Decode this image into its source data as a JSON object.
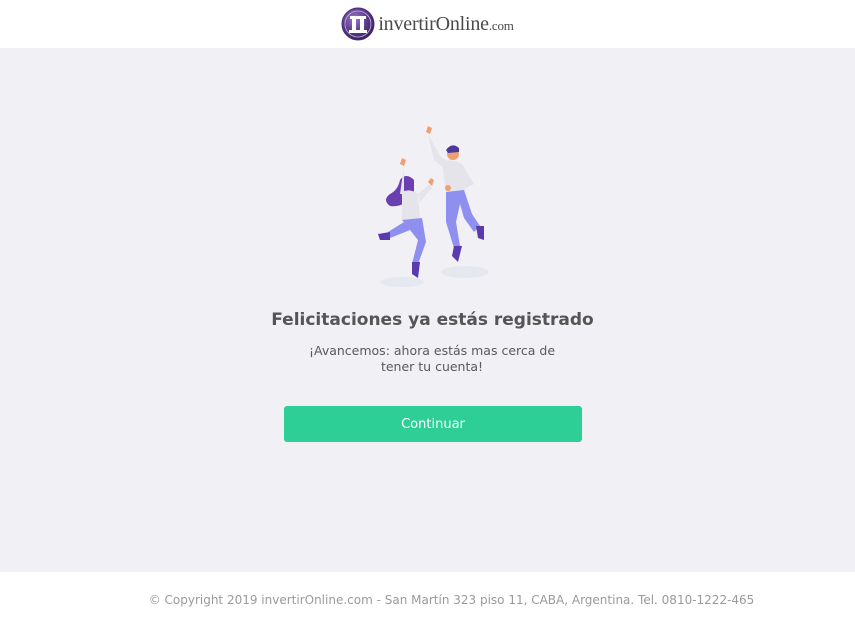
{
  "header": {
    "logo_main": "invertirOnline",
    "logo_suffix": ".com",
    "logo_mark_icon": "invertironline-logo-icon"
  },
  "main": {
    "illustration": "celebrating-people-illustration",
    "title": "Felicitaciones ya estás registrado",
    "subtitle_line1": "¡Avancemos: ahora estás mas cerca de",
    "subtitle_line2": "tener tu cuenta!",
    "continue_label": "Continuar"
  },
  "footer": {
    "copyright": "© Copyright 2019 invertirOnline.com - San Martín 323 piso 11, CABA, Argentina. Tel. 0810-1222-465"
  },
  "colors": {
    "accent": "#2ecf96",
    "brand_purple": "#5b3a8c",
    "background": "#f0f0f5"
  }
}
